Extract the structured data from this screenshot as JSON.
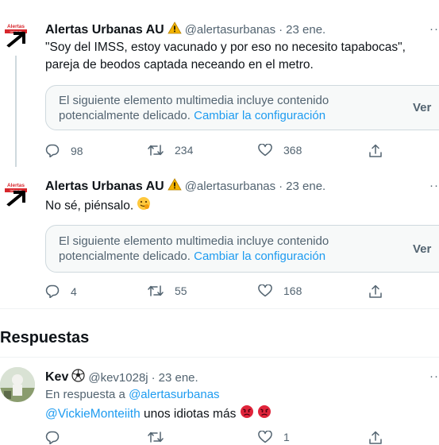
{
  "tweets": [
    {
      "author": "Alertas Urbanas AU",
      "handle": "@alertasurbanas",
      "separator": "·",
      "date": "23 ene.",
      "text": "\"Soy del IMSS, estoy vacunado y por eso no necesito tapabocas\", pareja de beodos captada neceando en el metro.",
      "warning": "El siguiente elemento multimedia incluye contenido potencialmente delicado.",
      "warning_link": "Cambiar la configuración",
      "view_label": "Ver",
      "replies": "98",
      "retweets": "234",
      "likes": "368"
    },
    {
      "author": "Alertas Urbanas AU",
      "handle": "@alertasurbanas",
      "separator": "·",
      "date": "23 ene.",
      "text": "No sé, piénsalo.",
      "warning": "El siguiente elemento multimedia incluye contenido potencialmente delicado.",
      "warning_link": "Cambiar la configuración",
      "view_label": "Ver",
      "replies": "4",
      "retweets": "55",
      "likes": "168"
    }
  ],
  "section_title": "Respuestas",
  "reply": {
    "author": "Kev",
    "handle": "@kev1028j",
    "separator": "·",
    "date": "23 ene.",
    "in_reply_prefix": "En respuesta a",
    "in_reply_handle": "@alertasurbanas",
    "mention": "@VickieMonteiith",
    "text": "unos idiotas más",
    "likes": "1"
  },
  "avatar_logo_text": "Alertas",
  "avatar_logo_subtext": "Urbanas",
  "colors": {
    "accent": "#1d9bf0",
    "muted": "#536471",
    "warning_icon": "#f4b400",
    "logo_red": "#d7262c"
  },
  "icons": [
    "warning-icon",
    "reply-icon",
    "retweet-icon",
    "like-icon",
    "share-icon",
    "more-icon",
    "smile-emoji-icon",
    "angry-emoji-icon",
    "soccer-ball-icon"
  ]
}
